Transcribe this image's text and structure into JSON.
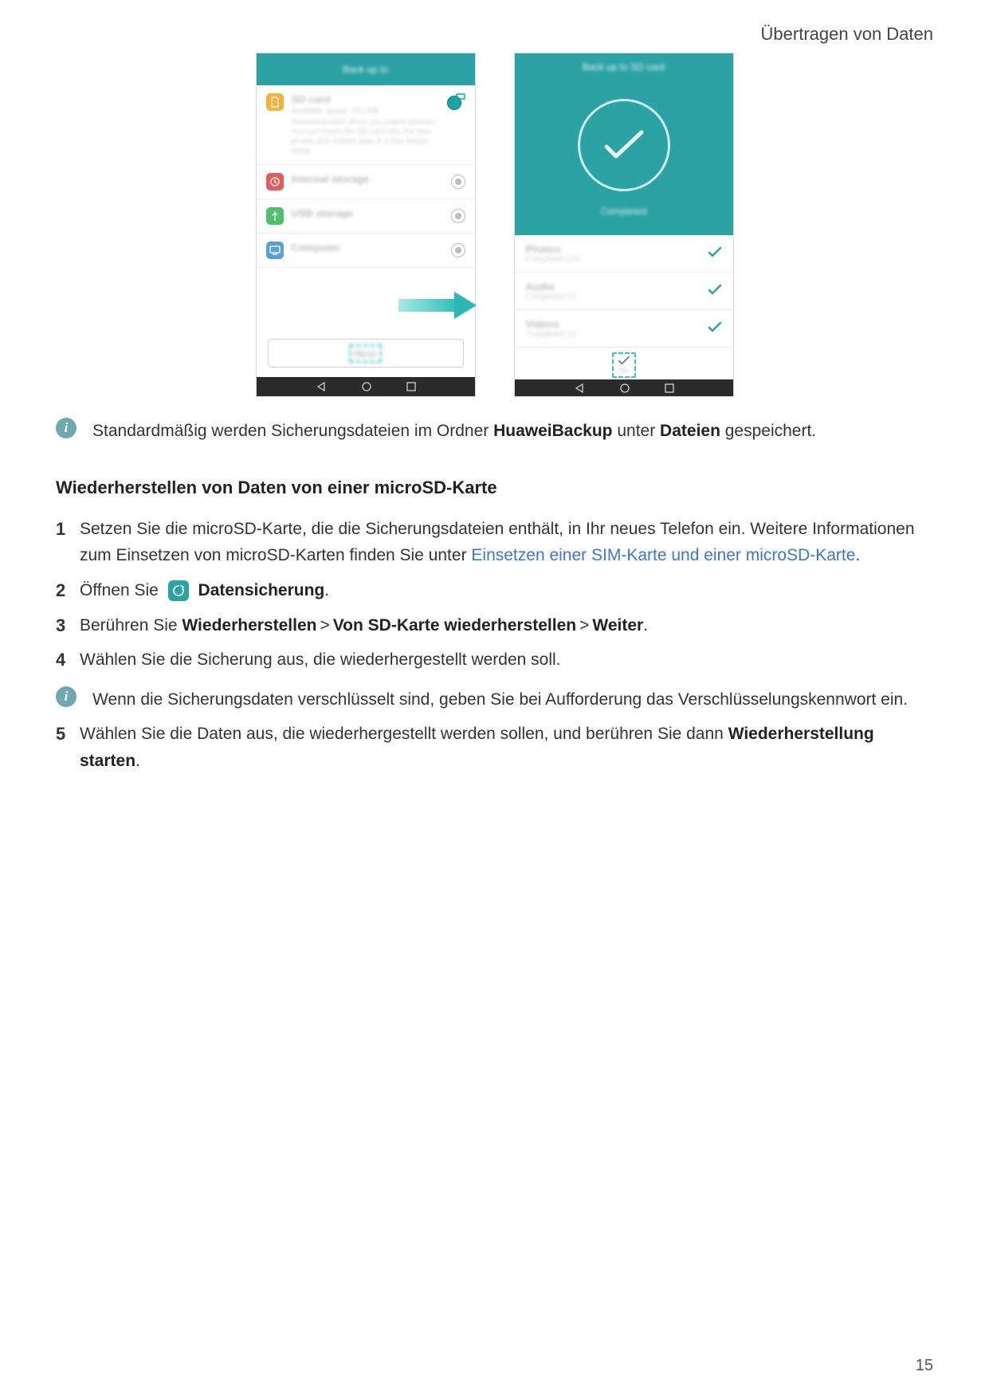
{
  "header": {
    "chapter": "Übertragen von Daten"
  },
  "page_number": "15",
  "blurred": {
    "phone1_title": "Back up to",
    "sd": "SD card",
    "sd_sub1": "Available space: 441 MB",
    "sd_sub2": "Recommended when you switch phones. You can insert the SD card into the new phone and restore data in a few simple steps.",
    "internal": "Internal storage",
    "usb": "USB storage",
    "computer": "Computer",
    "next": "Next",
    "phone2_title": "Back up to SD card",
    "completed": "Completed",
    "photos_t": "Photos",
    "photos_s": "Completed (24)",
    "audio_t": "Audio",
    "audio_s": "Completed (2)",
    "videos_t": "Videos",
    "videos_s": "Completed (1)",
    "ok": "OK"
  },
  "info1": {
    "pre": "Standardmäßig werden Sicherungsdateien im Ordner ",
    "b1": "HuaweiBackup",
    "mid": " unter ",
    "b2": "Dateien",
    "post": " gespeichert."
  },
  "section_heading": "Wiederherstellen von Daten von einer microSD-Karte",
  "step1": {
    "text": "Setzen Sie die microSD-Karte, die die Sicherungsdateien enthält, in Ihr neues Telefon ein. Weitere Informationen zum Einsetzen von microSD-Karten finden Sie unter ",
    "link": "Einsetzen einer SIM-Karte und einer microSD-Karte"
  },
  "step2": {
    "pre": "Öffnen Sie ",
    "app": "Datensicherung"
  },
  "step3": {
    "pre": "Berühren Sie ",
    "b1": "Wiederherstellen",
    "b2": "Von SD-Karte wiederherstellen",
    "b3": "Weiter"
  },
  "step4": {
    "text": "Wählen Sie die Sicherung aus, die wiederhergestellt werden soll."
  },
  "info2": {
    "text": "Wenn die Sicherungsdaten verschlüsselt sind, geben Sie bei Aufforderung das Verschlüsselungskennwort ein."
  },
  "step5": {
    "text": "Wählen Sie die Daten aus, die wiederhergestellt werden sollen, und berühren Sie dann ",
    "b1": "Wiederherstellung starten"
  },
  "glyphs": {
    "gt": ">",
    "period": "."
  },
  "chart_data": null
}
